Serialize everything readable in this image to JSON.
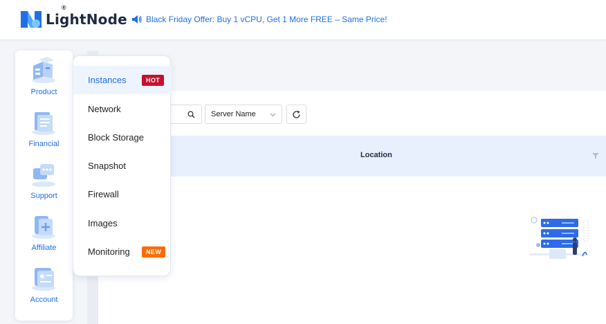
{
  "header": {
    "brand": "LightNode",
    "registered": "®",
    "promo_text": "Black Friday Offer: Buy 1 vCPU, Get 1 More FREE – Same Price!"
  },
  "left_nav": {
    "items": [
      {
        "label": "Product",
        "icon": "product-icon"
      },
      {
        "label": "Financial",
        "icon": "financial-icon"
      },
      {
        "label": "Support",
        "icon": "support-icon"
      },
      {
        "label": "Affiliate",
        "icon": "affiliate-icon"
      },
      {
        "label": "Account",
        "icon": "account-icon"
      }
    ]
  },
  "product_menu": {
    "items": [
      {
        "label": "Instances",
        "badge": "HOT",
        "active": true
      },
      {
        "label": "Network"
      },
      {
        "label": "Block Storage"
      },
      {
        "label": "Snapshot"
      },
      {
        "label": "Firewall"
      },
      {
        "label": "Images"
      },
      {
        "label": "Monitoring",
        "badge": "NEW"
      }
    ]
  },
  "toolbar": {
    "filter_select_value": "Server Name"
  },
  "table": {
    "columns": [
      "Location"
    ]
  },
  "colors": {
    "accent": "#1f6fe6",
    "hot_badge": "#c8102e",
    "new_badge": "#ff6a00",
    "table_header_bg": "#e8f0fe"
  }
}
